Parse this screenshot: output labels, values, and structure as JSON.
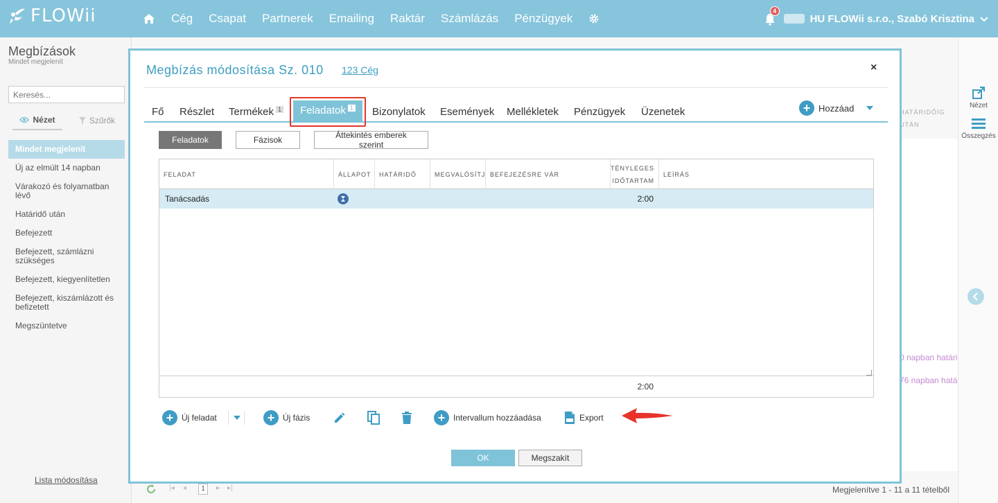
{
  "app": {
    "logo_text": "FLOWii",
    "nav": [
      "Cég",
      "Csapat",
      "Partnerek",
      "Emailing",
      "Raktár",
      "Számlázás",
      "Pénzügyek"
    ],
    "notification_count": "4",
    "user": "HU FLOWii s.r.o., Szabó Krisztina"
  },
  "sidebar": {
    "title": "Megbízások",
    "subtitle": "Mindet megjelenít",
    "search_placeholder": "Keresés...",
    "tab_view": "Nézet",
    "tab_filters": "Szűrők",
    "items": [
      "Mindet megjelenít",
      "Új az elmúlt 14 napban",
      "Várakozó és folyamatban lévő",
      "Határidő után",
      "Befejezett",
      "Befejezett, számlázni szükséges",
      "Befejezett, kiegyenlítetlen",
      "Befejezett, kiszámlázott és befizetett",
      "Megszüntetve"
    ],
    "footer_link": "Lista módosítása"
  },
  "background": {
    "col_head_line1": "HATÁRIDŐIG",
    "col_head_line2": "UTÁN",
    "pink_1": "0 napban határi",
    "pink_2": "76 napban hatá",
    "rail_view": "Nézet",
    "rail_summary": "Összegzés",
    "pager_page": "1",
    "pager_status": "Megjelenítve 1 - 11 a 11 tételből"
  },
  "modal": {
    "title": "Megbízás módosítása Sz. 010",
    "company_link": "123 Cég",
    "close": "×",
    "tabs": [
      {
        "label": "Fő"
      },
      {
        "label": "Részlet"
      },
      {
        "label": "Termékek",
        "badge": "1"
      },
      {
        "label": "Feladatok",
        "badge": "1"
      },
      {
        "label": "Bizonylatok"
      },
      {
        "label": "Események"
      },
      {
        "label": "Mellékletek"
      },
      {
        "label": "Pénzügyek"
      },
      {
        "label": "Üzenetek"
      }
    ],
    "add_label": "Hozzáad",
    "subbuttons": [
      "Feladatok",
      "Fázisok",
      "Áttekintés emberek szerint"
    ],
    "columns": {
      "task": "FELADAT",
      "state": "ÁLLAPOT",
      "deadline": "HATÁRIDŐ",
      "implementer": "MEGVALÓSÍTJA",
      "waiting": "BEFEJEZÉSRE VÁR",
      "actual_line1": "TÉNYLEGES",
      "actual_line2": "IDŐTARTAM",
      "description": "LEÍRÁS"
    },
    "rows": [
      {
        "task": "Tanácsadás",
        "duration": "2:00"
      }
    ],
    "total": "2:00",
    "actions": {
      "new_task": "Új feladat",
      "new_phase": "Új fázis",
      "add_interval": "Intervallum hozzáadása",
      "export": "Export"
    },
    "ok": "OK",
    "cancel": "Megszakít"
  },
  "colors": {
    "accent": "#7fc3d8",
    "topbar": "#87c5dc",
    "highlight": "#e0372c",
    "icon_blue": "#3f9cc4"
  }
}
